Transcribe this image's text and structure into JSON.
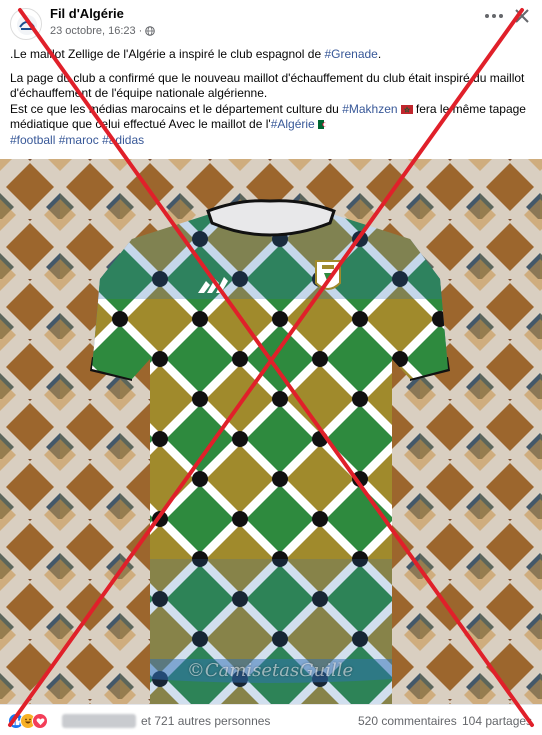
{
  "post": {
    "page_name": "Fil d'Algérie",
    "date": "23 octobre, 16:23",
    "date_separator": "·",
    "paragraph1_pre": ".Le maillot Zellige de l'Algérie a inspiré le club espagnol de ",
    "paragraph1_tag": "#Grenade",
    "paragraph1_post": ".",
    "paragraph2_a": " La page du club a confirmé que le nouveau maillot d'échauffement du club était inspiré du maillot d'échauffement de l'équipe nationale algérienne.",
    "paragraph2_b_pre": "Est ce que les médias marocains et le département culture du ",
    "paragraph2_b_tag": "#Makhzen",
    "paragraph2_b_mid": " fera le même tapage médiatique que celui effectué Avec le maillot de l'",
    "paragraph2_b_tag2": "#Algérie",
    "hashtags": [
      "#football",
      "#maroc",
      "#adidas"
    ]
  },
  "image": {
    "watermark": "©CamisetasGuille",
    "description_colors": {
      "jersey_blue": "#2f6fb3",
      "jersey_green": "#2e8a3e",
      "jersey_gold": "#9c8628",
      "tile_background": "#7a5a3a"
    }
  },
  "footer": {
    "others_text": "et 721 autres personnes",
    "comments_text": "520 commentaires",
    "shares_text": "104 partages"
  },
  "overlay": {
    "cross_color": "#e0202a"
  },
  "icons": {
    "globe": "globe-icon",
    "more": "more-options-icon",
    "close": "close-icon",
    "like": "like-reaction-icon",
    "haha": "haha-reaction-icon",
    "love": "love-reaction-icon"
  }
}
